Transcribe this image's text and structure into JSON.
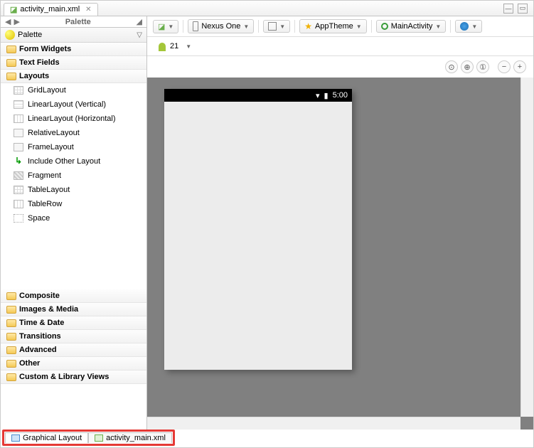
{
  "tab": {
    "filename": "activity_main.xml"
  },
  "palette": {
    "controls_label": "Palette",
    "header": "Palette",
    "folders": {
      "form_widgets": "Form Widgets",
      "text_fields": "Text Fields",
      "layouts": "Layouts",
      "composite": "Composite",
      "images_media": "Images & Media",
      "time_date": "Time & Date",
      "transitions": "Transitions",
      "advanced": "Advanced",
      "other": "Other",
      "custom": "Custom & Library Views"
    },
    "layouts_items": [
      "GridLayout",
      "LinearLayout (Vertical)",
      "LinearLayout (Horizontal)",
      "RelativeLayout",
      "FrameLayout",
      "Include Other Layout",
      "Fragment",
      "TableLayout",
      "TableRow",
      "Space"
    ]
  },
  "toolbar": {
    "device": "Nexus One",
    "theme": "AppTheme",
    "activity": "MainActivity",
    "api_level": "21"
  },
  "preview": {
    "time": "5:00"
  },
  "bottom_tabs": {
    "graphical": "Graphical Layout",
    "xml": "activity_main.xml"
  }
}
